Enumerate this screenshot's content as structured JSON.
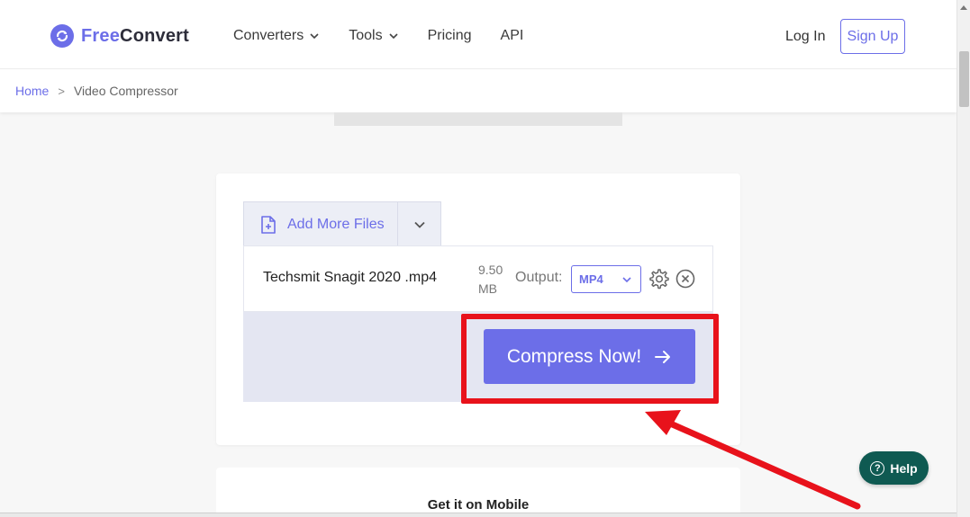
{
  "header": {
    "brand_part1": "Free",
    "brand_part2": "Convert",
    "nav": [
      {
        "label": "Converters"
      },
      {
        "label": "Tools"
      },
      {
        "label": "Pricing"
      },
      {
        "label": "API"
      }
    ],
    "login_label": "Log In",
    "signup_label": "Sign Up"
  },
  "breadcrumb": {
    "home": "Home",
    "separator": ">",
    "current": "Video Compressor"
  },
  "uploader": {
    "add_files_label": "Add More Files",
    "file": {
      "name": "Techsmit Snagit 2020 .mp4",
      "size_value": "9.50",
      "size_unit": "MB",
      "output_label": "Output:",
      "output_format": "MP4"
    },
    "compress_label": "Compress Now!"
  },
  "mobile": {
    "title": "Get it on Mobile"
  },
  "help": {
    "label": "Help",
    "icon_glyph": "?"
  },
  "colors": {
    "accent": "#6c6ee8",
    "highlight": "#e8121b",
    "help_bg": "#0f5a52"
  }
}
